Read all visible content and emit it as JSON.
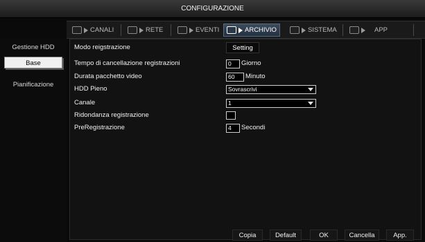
{
  "window": {
    "title": "CONFIGURAZIONE"
  },
  "tabs": [
    {
      "label": "CANALI",
      "icon": "camera-icon"
    },
    {
      "label": "RETE",
      "icon": "network-icon"
    },
    {
      "label": "EVENTI",
      "icon": "alarm-icon"
    },
    {
      "label": "ARCHIVIO",
      "icon": "storage-icon"
    },
    {
      "label": "SISTEMA",
      "icon": "system-icon"
    },
    {
      "label": "APP",
      "icon": "app-icon"
    }
  ],
  "active_tab": "ARCHIVIO",
  "sidebar": {
    "items": [
      {
        "label": "Gestione HDD"
      },
      {
        "label": "Base"
      },
      {
        "label": "Pianificazione"
      }
    ],
    "active": "Base"
  },
  "form": {
    "record_mode": {
      "label": "Modo reigstrazione",
      "button": "Setting"
    },
    "delete_time": {
      "label": "Tempo di cancellazione registrazioni",
      "value": "0",
      "unit": "Giorno"
    },
    "pack_duration": {
      "label": "Durata pacchetto video",
      "value": "60",
      "unit": "Minuto"
    },
    "hdd_full": {
      "label": "HDD Pieno",
      "value": "Sovrascrivi"
    },
    "channel": {
      "label": "Canale",
      "value": "1"
    },
    "redundancy": {
      "label": "Ridondanza registrazione",
      "checked": false
    },
    "prerecord": {
      "label": "PreRegistrazione",
      "value": "4",
      "unit": "Secondi"
    }
  },
  "buttons": {
    "copy": "Copia",
    "default": "Default",
    "ok": "OK",
    "cancel": "Cancella",
    "apply": "App."
  },
  "colors": {
    "active_tab": "#3d4c5c",
    "background": "#0a0a0a",
    "panel": "#121212"
  }
}
